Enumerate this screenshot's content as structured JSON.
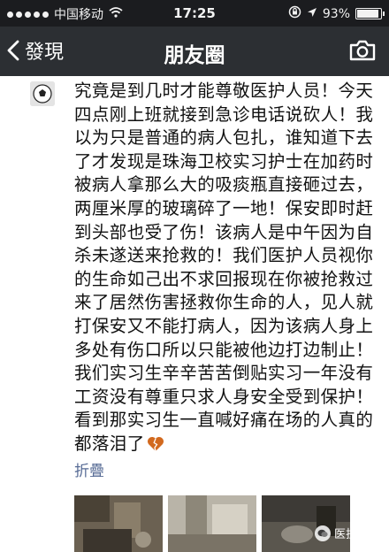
{
  "status_bar": {
    "carrier": "中国移动",
    "time": "17:25",
    "battery_text": "93%",
    "battery_level": 0.93
  },
  "nav": {
    "back_label": "發現",
    "title": "朋友圈"
  },
  "post": {
    "text": "究竟是到几时才能尊敬医护人员！今天四点刚上班就接到急诊电话说砍人！我以为只是普通的病人包扎，谁知道下去了才发现是珠海卫校实习护士在加药时被病人拿那么大的吸痰瓶直接砸过去，两厘米厚的玻璃碎了一地！保安即时赶到头部也受了伤！该病人是中午因为自杀未遂送来抢救的！我们医护人员视你的生命如己出不求回报现在你被抢救过来了居然伤害拯救你生命的人，见人就打保安又不能打病人，因为该病人身上多处有伤口所以只能被他边打边制止！我们实习生辛辛苦苦倒贴实习一年没有工资没有尊重只求人身安全受到保护！看到那实习生一直喊好痛在场的人真的都落泪了",
    "emoji": "broken-heart-icon",
    "collapse_label": "折疊"
  },
  "watermark": {
    "text": "医护之家"
  },
  "colors": {
    "status_bar_bg": "#1b1c1f",
    "nav_bg": "#2c2f33",
    "link": "#576b95",
    "heart": "#d2691e"
  }
}
